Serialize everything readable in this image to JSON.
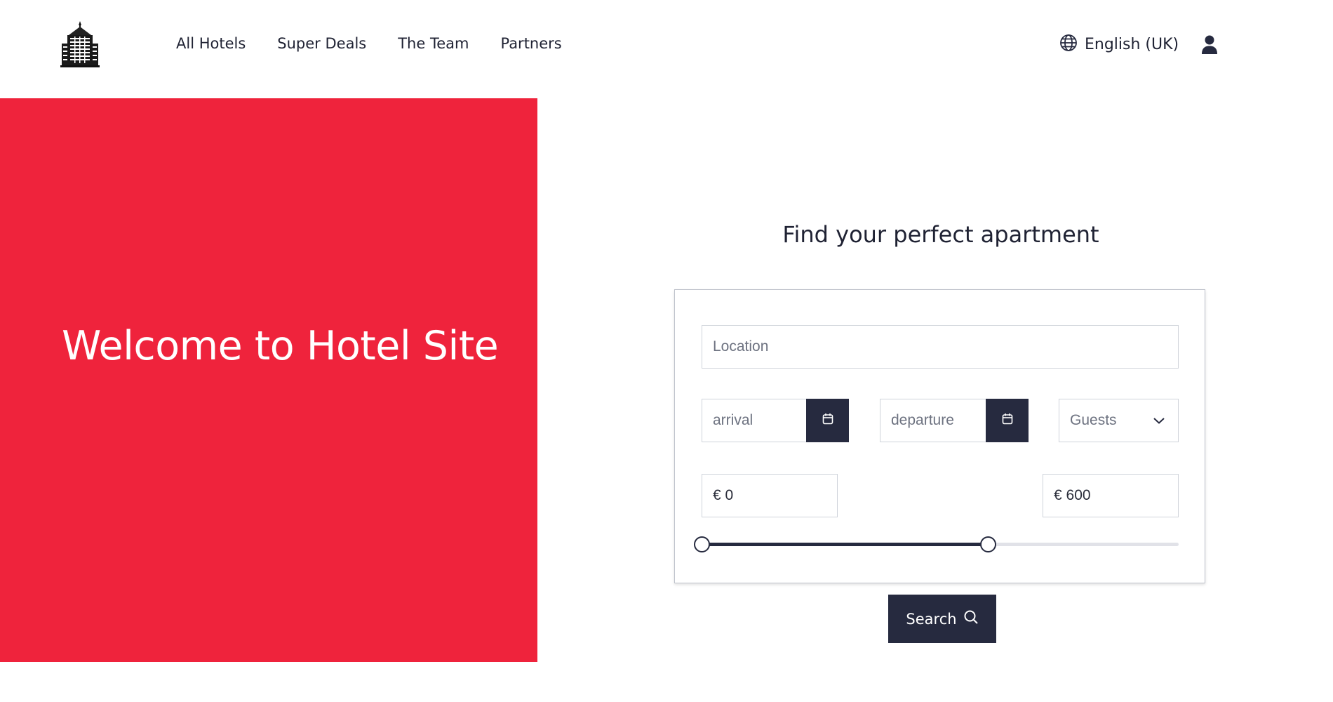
{
  "header": {
    "logo_icon": "hotel-building-icon",
    "nav": [
      "All Hotels",
      "Super Deals",
      "The Team",
      "Partners"
    ],
    "language": {
      "icon": "globe-icon",
      "label": "English (UK)"
    },
    "user_icon": "user-icon"
  },
  "hero": {
    "title": "Welcome to Hotel Site",
    "background_color": "#ef233c"
  },
  "search": {
    "title": "Find your perfect apartment",
    "location_placeholder": "Location",
    "arrival_placeholder": "arrival",
    "departure_placeholder": "departure",
    "calendar_icon": "calendar-icon",
    "guests_label": "Guests",
    "guests_icon": "chevron-down-icon",
    "min_price": "€ 0",
    "max_price": "€ 600",
    "slider": {
      "min_fraction": 0.0,
      "max_fraction": 0.6
    },
    "button_label": "Search",
    "button_icon": "search-icon",
    "accent_color": "#262a3f"
  }
}
